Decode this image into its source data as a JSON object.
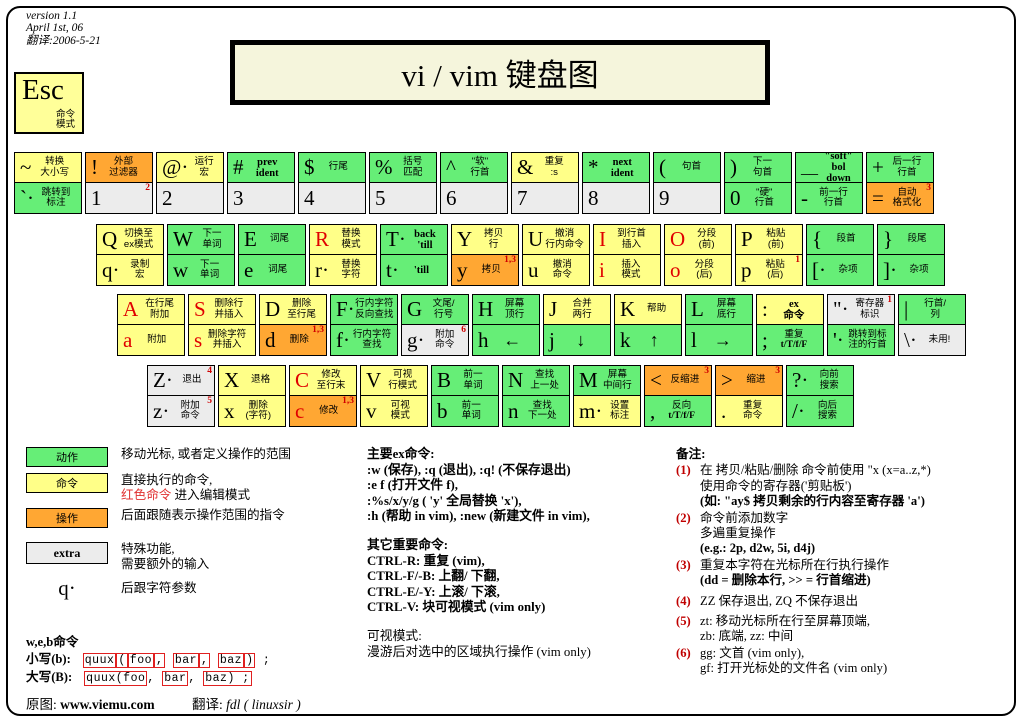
{
  "meta": {
    "version_lines": [
      "version 1.1",
      "April 1st, 06",
      "翻译:2006-5-21"
    ],
    "title": "vi / vim 键盘图",
    "esc_glyph": "Esc",
    "esc_label": "命令\n模式"
  },
  "colors": {
    "motion": "#66ee77",
    "command": "#ffff88",
    "operator": "#ffa733",
    "extra": "#ececec",
    "red": "#e00000",
    "title_bg": "#f5f5dc"
  },
  "rows": {
    "number_row": [
      {
        "name": "tilde-backtick",
        "top": {
          "glyph": "~",
          "label": "转换\n大小写",
          "color": "y"
        },
        "bottom": {
          "glyph": "`",
          "dot": true,
          "label": "跳转到\n标注",
          "color": "g"
        }
      },
      {
        "name": "bang-1",
        "top": {
          "glyph": "!",
          "label": "外部\n过滤器",
          "color": "o"
        },
        "bottom": {
          "glyph": "1",
          "label": "",
          "color": "w",
          "sup": "2"
        }
      },
      {
        "name": "at-2",
        "top": {
          "glyph": "@",
          "dot": true,
          "label": "运行\n宏",
          "color": "y"
        },
        "bottom": {
          "glyph": "2",
          "label": "",
          "color": "w"
        }
      },
      {
        "name": "hash-3",
        "top": {
          "glyph": "#",
          "label": "prev\nident",
          "color": "g",
          "en": true
        },
        "bottom": {
          "glyph": "3",
          "label": "",
          "color": "w"
        }
      },
      {
        "name": "dollar-4",
        "top": {
          "glyph": "$",
          "label": "行尾",
          "color": "g"
        },
        "bottom": {
          "glyph": "4",
          "label": "",
          "color": "w"
        }
      },
      {
        "name": "percent-5",
        "top": {
          "glyph": "%",
          "label": "括号\n匹配",
          "color": "g"
        },
        "bottom": {
          "glyph": "5",
          "label": "",
          "color": "w"
        }
      },
      {
        "name": "caret-6",
        "top": {
          "glyph": "^",
          "label": "\"软\"\n行首",
          "color": "g"
        },
        "bottom": {
          "glyph": "6",
          "label": "",
          "color": "w"
        }
      },
      {
        "name": "amp-7",
        "top": {
          "glyph": "&",
          "label": "重复\n:s",
          "color": "y"
        },
        "bottom": {
          "glyph": "7",
          "label": "",
          "color": "w"
        }
      },
      {
        "name": "star-8",
        "top": {
          "glyph": "*",
          "label": "next\nident",
          "color": "g",
          "en": true
        },
        "bottom": {
          "glyph": "8",
          "label": "",
          "color": "w"
        }
      },
      {
        "name": "paren-open-9",
        "top": {
          "glyph": "(",
          "label": "句首",
          "color": "g"
        },
        "bottom": {
          "glyph": "9",
          "label": "",
          "color": "w"
        }
      },
      {
        "name": "paren-close-0",
        "top": {
          "glyph": ")",
          "label": "下一\n句首",
          "color": "g"
        },
        "bottom": {
          "glyph": "0",
          "label": "\"硬\"\n行首",
          "color": "g"
        }
      },
      {
        "name": "underscore-minus",
        "top": {
          "glyph": "__",
          "label": "\"soft\" bol\ndown",
          "color": "g",
          "en": true
        },
        "bottom": {
          "glyph": "-",
          "label": "前一行\n行首",
          "color": "g"
        }
      },
      {
        "name": "plus-equal",
        "top": {
          "glyph": "+",
          "label": "后一行\n行首",
          "color": "g"
        },
        "bottom": {
          "glyph": "=",
          "label": "自动\n格式化",
          "color": "o",
          "sup": "3"
        }
      }
    ],
    "qwerty_row": [
      {
        "name": "key-q",
        "top": {
          "glyph": "Q",
          "label": "切换至\nex模式",
          "color": "y",
          "enbold2": true
        },
        "bottom": {
          "glyph": "q",
          "dot": true,
          "label": "录制\n宏",
          "color": "y"
        }
      },
      {
        "name": "key-w",
        "top": {
          "glyph": "W",
          "label": "下一\n单词",
          "color": "g"
        },
        "bottom": {
          "glyph": "w",
          "label": "下一\n单词",
          "color": "g"
        }
      },
      {
        "name": "key-e",
        "top": {
          "glyph": "E",
          "label": "词尾",
          "color": "g"
        },
        "bottom": {
          "glyph": "e",
          "label": "词尾",
          "color": "g"
        }
      },
      {
        "name": "key-r",
        "top": {
          "glyph": "R",
          "label": "替换\n模式",
          "color": "y",
          "red": true
        },
        "bottom": {
          "glyph": "r",
          "dot": true,
          "label": "替换\n字符",
          "color": "y"
        }
      },
      {
        "name": "key-t",
        "top": {
          "glyph": "T",
          "dot": true,
          "label": "back\n'till",
          "color": "g",
          "en": true
        },
        "bottom": {
          "glyph": "t",
          "dot": true,
          "label": "'till",
          "color": "g",
          "en": true
        }
      },
      {
        "name": "key-y",
        "top": {
          "glyph": "Y",
          "label": "拷贝\n行",
          "color": "y"
        },
        "bottom": {
          "glyph": "y",
          "label": "拷贝",
          "color": "o",
          "sup": "1,3"
        }
      },
      {
        "name": "key-u",
        "top": {
          "glyph": "U",
          "label": "撤消\n行内命令",
          "color": "y"
        },
        "bottom": {
          "glyph": "u",
          "label": "撤消\n命令",
          "color": "y"
        }
      },
      {
        "name": "key-i",
        "top": {
          "glyph": "I",
          "label": "到行首\n插入",
          "color": "y",
          "red": true
        },
        "bottom": {
          "glyph": "i",
          "label": "插入\n模式",
          "color": "y",
          "red": true
        }
      },
      {
        "name": "key-o",
        "top": {
          "glyph": "O",
          "label": "分段\n(前)",
          "color": "y",
          "red": true
        },
        "bottom": {
          "glyph": "o",
          "label": "分段\n(后)",
          "color": "y",
          "red": true
        }
      },
      {
        "name": "key-p",
        "top": {
          "glyph": "P",
          "label": "粘贴\n(前)",
          "color": "y"
        },
        "bottom": {
          "glyph": "p",
          "label": "粘贴\n(后)",
          "color": "y",
          "sup": "1"
        }
      },
      {
        "name": "key-brace-open",
        "top": {
          "glyph": "{",
          "label": "段首",
          "color": "g"
        },
        "bottom": {
          "glyph": "[",
          "dot": true,
          "label": "杂项",
          "color": "g"
        }
      },
      {
        "name": "key-brace-close",
        "top": {
          "glyph": "}",
          "label": "段尾",
          "color": "g"
        },
        "bottom": {
          "glyph": "]",
          "dot": true,
          "label": "杂项",
          "color": "g"
        }
      }
    ],
    "home_row": [
      {
        "name": "key-a",
        "top": {
          "glyph": "A",
          "label": "在行尾\n附加",
          "color": "y",
          "red": true
        },
        "bottom": {
          "glyph": "a",
          "label": "附加",
          "color": "y",
          "red": true
        }
      },
      {
        "name": "key-s",
        "top": {
          "glyph": "S",
          "label": "删除行\n并插入",
          "color": "y",
          "red": true
        },
        "bottom": {
          "glyph": "s",
          "label": "删除字符\n并插入",
          "color": "y",
          "red": true
        }
      },
      {
        "name": "key-d",
        "top": {
          "glyph": "D",
          "label": "删除\n至行尾",
          "color": "y"
        },
        "bottom": {
          "glyph": "d",
          "label": "删除",
          "color": "o",
          "sup": "1,3"
        }
      },
      {
        "name": "key-f",
        "top": {
          "glyph": "F",
          "dot": true,
          "label": "行内字符\n反向查找",
          "color": "g"
        },
        "bottom": {
          "glyph": "f",
          "dot": true,
          "label": "行内字符\n查找",
          "color": "g"
        }
      },
      {
        "name": "key-g",
        "top": {
          "glyph": "G",
          "label": "文尾/\n行号",
          "color": "g"
        },
        "bottom": {
          "glyph": "g",
          "dot": true,
          "label": "附加\n命令",
          "color": "w",
          "sup": "6"
        }
      },
      {
        "name": "key-h",
        "top": {
          "glyph": "H",
          "label": "屏幕\n顶行",
          "color": "g"
        },
        "bottom": {
          "glyph": "h",
          "label": "←",
          "color": "g",
          "arrow": true
        }
      },
      {
        "name": "key-j",
        "top": {
          "glyph": "J",
          "label": "合并\n两行",
          "color": "y"
        },
        "bottom": {
          "glyph": "j",
          "label": "↓",
          "color": "g",
          "arrow": true
        }
      },
      {
        "name": "key-k",
        "top": {
          "glyph": "K",
          "label": "帮助",
          "color": "y"
        },
        "bottom": {
          "glyph": "k",
          "label": "↑",
          "color": "g",
          "arrow": true
        }
      },
      {
        "name": "key-l",
        "top": {
          "glyph": "L",
          "label": "屏幕\n底行",
          "color": "g"
        },
        "bottom": {
          "glyph": "l",
          "label": "→",
          "color": "g",
          "arrow": true
        }
      },
      {
        "name": "key-colon",
        "top": {
          "glyph": ":",
          "label": "ex\n命令",
          "color": "y",
          "en": true
        },
        "bottom": {
          "glyph": ";",
          "label": "重复\nt/T/f/F",
          "color": "g",
          "en2": true
        }
      },
      {
        "name": "key-quote",
        "top": {
          "glyph": "\"",
          "dot": true,
          "label": "寄存器\n标识",
          "color": "w",
          "sup": "1"
        },
        "bottom": {
          "glyph": "'",
          "dot": true,
          "label": "跳转到标\n注的行首",
          "color": "g"
        }
      },
      {
        "name": "key-backslash",
        "top": {
          "glyph": "|",
          "label": "行首/\n列",
          "color": "g"
        },
        "bottom": {
          "glyph": "\\",
          "dot": true,
          "label": "未用!",
          "color": "w"
        }
      }
    ],
    "bottom_row": [
      {
        "name": "key-z",
        "top": {
          "glyph": "Z",
          "dot": true,
          "label": "退出",
          "color": "w",
          "sup": "4"
        },
        "bottom": {
          "glyph": "z",
          "dot": true,
          "label": "附加\n命令",
          "color": "w",
          "sup": "5"
        }
      },
      {
        "name": "key-x",
        "top": {
          "glyph": "X",
          "label": "退格",
          "color": "y"
        },
        "bottom": {
          "glyph": "x",
          "label": "删除\n(字符)",
          "color": "y"
        }
      },
      {
        "name": "key-c",
        "top": {
          "glyph": "C",
          "label": "修改\n至行末",
          "color": "y",
          "red": true
        },
        "bottom": {
          "glyph": "c",
          "label": "修改",
          "color": "o",
          "red": true,
          "sup": "1,3"
        }
      },
      {
        "name": "key-v",
        "top": {
          "glyph": "V",
          "label": "可视\n行模式",
          "color": "y"
        },
        "bottom": {
          "glyph": "v",
          "label": "可视\n模式",
          "color": "y"
        }
      },
      {
        "name": "key-b",
        "top": {
          "glyph": "B",
          "label": "前一\n单词",
          "color": "g"
        },
        "bottom": {
          "glyph": "b",
          "label": "前一\n单词",
          "color": "g"
        }
      },
      {
        "name": "key-n",
        "top": {
          "glyph": "N",
          "label": "查找\n上一处",
          "color": "g"
        },
        "bottom": {
          "glyph": "n",
          "label": "查找\n下一处",
          "color": "g"
        }
      },
      {
        "name": "key-m",
        "top": {
          "glyph": "M",
          "label": "屏幕\n中间行",
          "color": "g"
        },
        "bottom": {
          "glyph": "m",
          "dot": true,
          "label": "设置\n标注",
          "color": "y"
        }
      },
      {
        "name": "key-lt",
        "top": {
          "glyph": "<",
          "label": "反缩进",
          "color": "o",
          "sup": "3"
        },
        "bottom": {
          "glyph": ",",
          "label": "反向\nt/T/f/F",
          "color": "g",
          "en2": true
        }
      },
      {
        "name": "key-gt",
        "top": {
          "glyph": ">",
          "label": "缩进",
          "color": "o",
          "sup": "3"
        },
        "bottom": {
          "glyph": ".",
          "label": "重复\n命令",
          "color": "y"
        }
      },
      {
        "name": "key-question",
        "top": {
          "glyph": "?",
          "dot": true,
          "label": "向前\n搜索",
          "color": "g"
        },
        "bottom": {
          "glyph": "/",
          "dot": true,
          "label": "向后\n搜索",
          "color": "g"
        }
      }
    ]
  },
  "legend": {
    "items": [
      {
        "chip": "动作",
        "color": "g",
        "desc": "移动光标, 或者定义操作的范围"
      },
      {
        "chip": "命令",
        "color": "y",
        "desc_line1": "直接执行的命令,",
        "desc_red": "红色命令",
        "desc_line2": " 进入编辑模式"
      },
      {
        "chip": "操作",
        "color": "o",
        "desc": "后面跟随表示操作范围的指令"
      },
      {
        "chip": "extra",
        "color": "w",
        "desc_line1": "特殊功能,",
        "desc_line2": "需要额外的输入"
      }
    ],
    "q_glyph": "q·",
    "q_desc": "后跟字符参数"
  },
  "web_example": {
    "heading": "w,e,b命令",
    "lower_label": "小写(b):",
    "lower_text": "quux(foo, bar, baz) ;",
    "upper_label": "大写(B):",
    "upper_text": "quux(foo, bar, baz) ;"
  },
  "credit": {
    "orig_label": "原图:",
    "site": "www.viemu.com",
    "trans_label": "翻译:",
    "translator": "fdl ( linuxsir )"
  },
  "mid_column": {
    "ex_heading": "主要ex命令:",
    "ex_lines": [
      ":w (保存), :q (退出), :q! (不保存退出)",
      ":e f (打开文件  f),",
      ":%s/x/y/g ( 'y' 全局替换  'x'),",
      ":h (帮助  in vim), :new (新建文件  in vim),"
    ],
    "other_heading": "其它重要命令:",
    "other_lines": [
      "CTRL-R: 重复  (vim),",
      "CTRL-F/-B: 上翻/ 下翻,",
      "CTRL-E/-Y: 上滚/ 下滚,",
      "CTRL-V: 块可视模式  (vim only)"
    ],
    "visual_heading": "可视模式:",
    "visual_line": "漫游后对选中的区域执行操作  (vim only)"
  },
  "right_column": {
    "heading": "备注:",
    "notes": [
      {
        "num": "(1)",
        "lines": [
          "在 拷贝/粘贴/删除 命令前使用 \"x (x=a..z,*)",
          "使用命令的寄存器('剪贴板')",
          "(如: \"ay$ 拷贝剩余的行内容至寄存器 'a')"
        ]
      },
      {
        "num": "(2)",
        "lines": [
          "命令前添加数字",
          "多遍重复操作",
          "(e.g.: 2p, d2w, 5i, d4j)"
        ]
      },
      {
        "num": "(3)",
        "lines": [
          "重复本字符在光标所在行执行操作",
          "(dd = 删除本行, >> = 行首缩进)"
        ]
      },
      {
        "num": "(4)",
        "lines": [
          "ZZ 保存退出, ZQ 不保存退出"
        ]
      },
      {
        "num": "(5)",
        "lines": [
          "zt: 移动光标所在行至屏幕顶端,",
          "zb: 底端, zz: 中间"
        ]
      },
      {
        "num": "(6)",
        "lines": [
          "gg: 文首  (vim only),",
          "gf: 打开光标处的文件名  (vim only)"
        ]
      }
    ]
  }
}
